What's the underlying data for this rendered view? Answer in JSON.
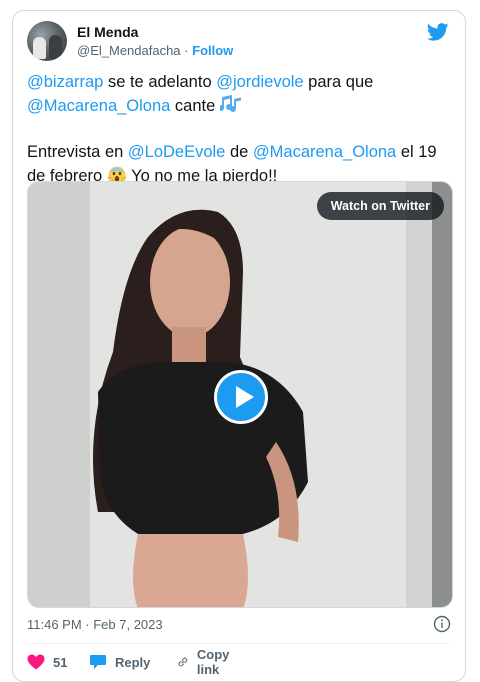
{
  "author": {
    "name": "El Menda",
    "handle": "@El_Mendafacha",
    "separator": "·",
    "follow_label": "Follow"
  },
  "tweet": {
    "line1": {
      "mention_a": "@bizarrap",
      "mid": " se te adelanto ",
      "mention_b": "@jordievole",
      "tail": " para que"
    },
    "line2": {
      "mention": "@Macarena_Olona",
      "tail": " cante "
    },
    "para2": {
      "lead": "Entrevista en ",
      "mention_a": "@LoDeEvole",
      "mid": " de ",
      "mention_b": "@Macarena_Olona",
      "tail1": " el 19 de febrero ",
      "tail2": " Yo no me la pierdo!!"
    }
  },
  "media": {
    "watch_label": "Watch on Twitter"
  },
  "timestamp": "11:46 PM · Feb 7, 2023",
  "actions": {
    "likes": "51",
    "reply_label": "Reply",
    "copy_label": "Copy link"
  },
  "colors": {
    "accent": "#1d9bf0",
    "like": "#f91880",
    "text": "#0f1419",
    "muted": "#536471"
  },
  "icons": [
    "twitter-bird-icon",
    "music-notes-emoji",
    "screaming-face-emoji",
    "play-icon",
    "info-icon",
    "heart-icon",
    "reply-icon",
    "link-icon"
  ]
}
